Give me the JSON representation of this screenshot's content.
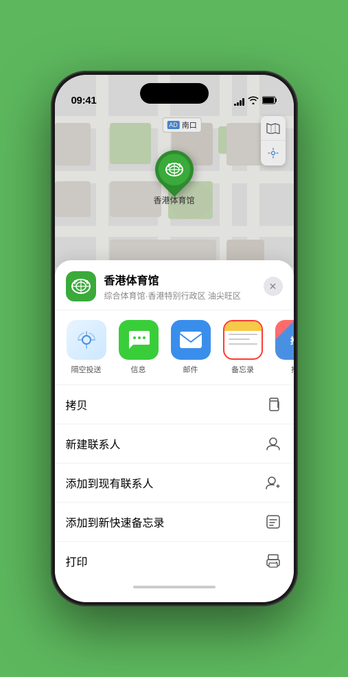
{
  "status_bar": {
    "time": "09:41",
    "signal_label": "signal",
    "wifi_label": "wifi",
    "battery_label": "battery"
  },
  "map": {
    "label": "南口",
    "label_prefix": "AD"
  },
  "pin": {
    "label": "香港体育馆",
    "emoji": "🏟"
  },
  "location_card": {
    "name": "香港体育馆",
    "description": "综合体育馆·香港特别行政区 油尖旺区",
    "icon_emoji": "🏟"
  },
  "share_items": [
    {
      "id": "airdrop",
      "label": "隔空投送"
    },
    {
      "id": "message",
      "label": "信息"
    },
    {
      "id": "mail",
      "label": "邮件"
    },
    {
      "id": "notes",
      "label": "备忘录"
    },
    {
      "id": "more",
      "label": "推"
    }
  ],
  "menu_items": [
    {
      "label": "拷贝",
      "icon": "copy"
    },
    {
      "label": "新建联系人",
      "icon": "person"
    },
    {
      "label": "添加到现有联系人",
      "icon": "person-add"
    },
    {
      "label": "添加到新快速备忘录",
      "icon": "note"
    },
    {
      "label": "打印",
      "icon": "print"
    }
  ]
}
